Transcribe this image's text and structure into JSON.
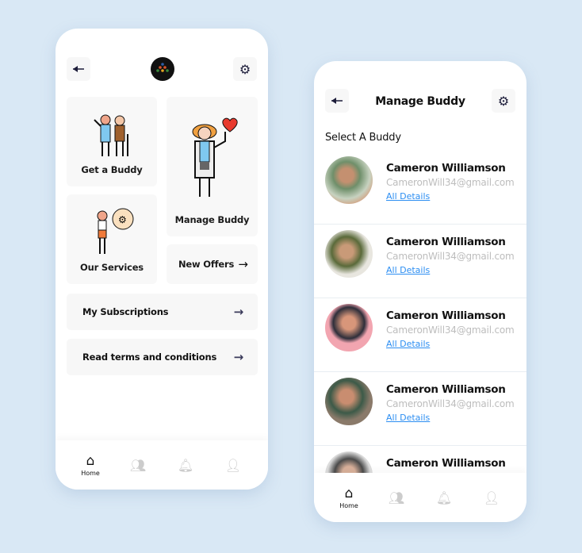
{
  "home": {
    "cards": {
      "get_buddy": "Get a Buddy",
      "our_services": "Our Services",
      "manage_buddy": "Manage Buddy",
      "new_offers": "New Offers"
    },
    "links": [
      "My Subscriptions",
      "Read terms and conditions"
    ],
    "nav": {
      "home": "Home"
    }
  },
  "manage": {
    "title": "Manage Buddy",
    "section": "Select A Buddy",
    "buddies": [
      {
        "name": "Cameron Williamson",
        "email": "CameronWill34@gmail.com",
        "link": "All Details"
      },
      {
        "name": "Cameron Williamson",
        "email": "CameronWill34@gmail.com",
        "link": "All Details"
      },
      {
        "name": "Cameron Williamson",
        "email": "CameronWill34@gmail.com",
        "link": "All Details"
      },
      {
        "name": "Cameron Williamson",
        "email": "CameronWill34@gmail.com",
        "link": "All Details"
      },
      {
        "name": "Cameron Williamson",
        "email": "",
        "link": ""
      }
    ],
    "nav": {
      "home": "Home"
    }
  },
  "colors": {
    "link": "#2c8ef2",
    "background": "#d9e8f5"
  }
}
